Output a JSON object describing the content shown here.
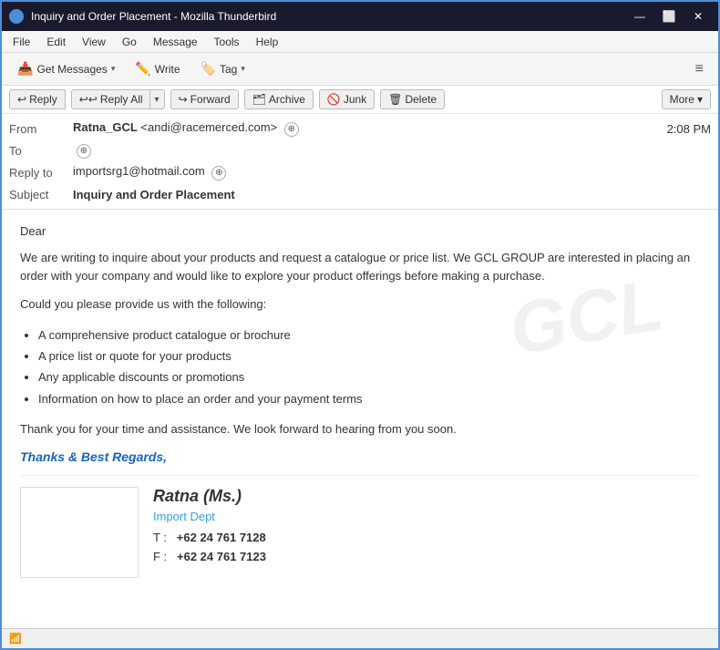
{
  "window": {
    "title": "Inquiry and Order Placement - Mozilla Thunderbird",
    "icon": "thunderbird-icon"
  },
  "titlebar": {
    "title": "Inquiry and Order Placement - Mozilla Thunderbird",
    "minimize_label": "—",
    "maximize_label": "⬜",
    "close_label": "✕"
  },
  "menubar": {
    "items": [
      "File",
      "Edit",
      "View",
      "Go",
      "Message",
      "Tools",
      "Help"
    ]
  },
  "toolbar": {
    "get_messages_label": "Get Messages",
    "write_label": "Write",
    "tag_label": "Tag",
    "hamburger": "≡"
  },
  "action_toolbar": {
    "reply_label": "Reply",
    "reply_all_label": "Reply All",
    "forward_label": "Forward",
    "archive_label": "Archive",
    "junk_label": "Junk",
    "delete_label": "Delete",
    "more_label": "More"
  },
  "email": {
    "from_label": "From",
    "from_name": "Ratna_GCL",
    "from_email": "<andi@racemerced.com>",
    "to_label": "To",
    "reply_to_label": "Reply to",
    "reply_to_email": "importsrg1@hotmail.com",
    "subject_label": "Subject",
    "subject_value": "Inquiry and Order Placement",
    "time": "2:08 PM"
  },
  "body": {
    "dear": "Dear",
    "dear_name": "",
    "paragraph1": "We are writing to inquire about your products and request a catalogue or price list. We GCL GROUP are interested in placing an order with your company and would like to explore your product offerings before making a purchase.",
    "paragraph2": "Could you please provide us with the following:",
    "list_items": [
      "A comprehensive product catalogue or brochure",
      "A price list or quote for your products",
      "Any applicable discounts or promotions",
      "Information on how to place an order and your payment terms"
    ],
    "paragraph3": "Thank you for your time and assistance. We look forward to hearing from you soon.",
    "thanks": "Thanks & Best Regards,",
    "sig_name": "Ratna (Ms.)",
    "sig_dept": "Import Dept",
    "sig_phone_label": "T :",
    "sig_phone": "+62 24 761 7128",
    "sig_fax_label": "F :",
    "sig_fax": "+62 24 761 7123"
  },
  "statusbar": {
    "signal_icon": "signal-icon"
  }
}
